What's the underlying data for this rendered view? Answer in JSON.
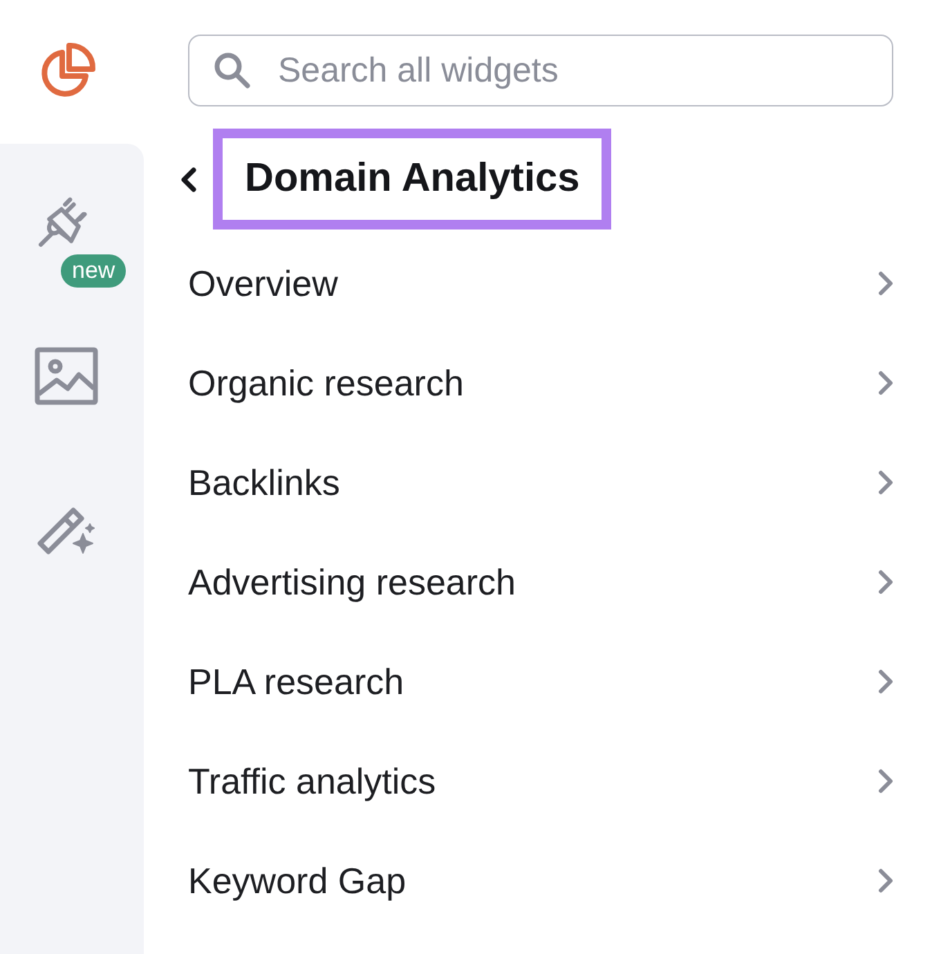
{
  "rail": {
    "new_badge": "new"
  },
  "search": {
    "placeholder": "Search all widgets"
  },
  "header": {
    "title": "Domain Analytics",
    "highlighted": true
  },
  "items": [
    {
      "label": "Overview"
    },
    {
      "label": "Organic research"
    },
    {
      "label": "Backlinks"
    },
    {
      "label": "Advertising research"
    },
    {
      "label": "PLA research"
    },
    {
      "label": "Traffic analytics"
    },
    {
      "label": "Keyword Gap"
    }
  ]
}
